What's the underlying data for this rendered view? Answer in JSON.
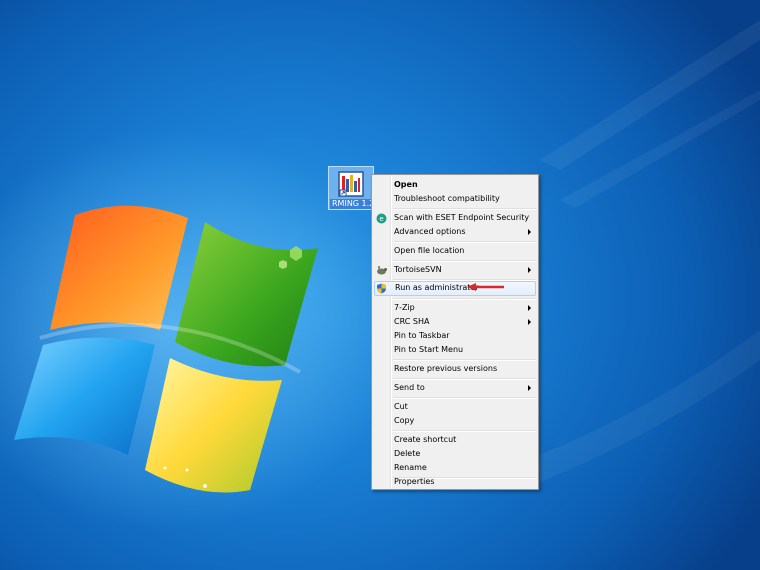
{
  "desktop": {
    "icon_label": "RMING 1.24",
    "accent_color": "#1a7fd4"
  },
  "context_menu": {
    "items": [
      {
        "label": "Open",
        "bold": true,
        "submenu": false,
        "icon": ""
      },
      {
        "label": "Troubleshoot compatibility",
        "bold": false,
        "submenu": false,
        "icon": ""
      },
      {
        "label": "Scan with ESET Endpoint Security",
        "bold": false,
        "submenu": false,
        "icon": "eset-icon"
      },
      {
        "label": "Advanced options",
        "bold": false,
        "submenu": true,
        "icon": ""
      },
      {
        "label": "Open file location",
        "bold": false,
        "submenu": false,
        "icon": ""
      },
      {
        "label": "TortoiseSVN",
        "bold": false,
        "submenu": true,
        "icon": "tortoise-svn-icon"
      },
      {
        "label": "Run as administrator",
        "bold": false,
        "submenu": false,
        "icon": "uac-shield-icon",
        "highlighted": true
      },
      {
        "label": "7-Zip",
        "bold": false,
        "submenu": true,
        "icon": ""
      },
      {
        "label": "CRC SHA",
        "bold": false,
        "submenu": true,
        "icon": ""
      },
      {
        "label": "Pin to Taskbar",
        "bold": false,
        "submenu": false,
        "icon": ""
      },
      {
        "label": "Pin to Start Menu",
        "bold": false,
        "submenu": false,
        "icon": ""
      },
      {
        "label": "Restore previous versions",
        "bold": false,
        "submenu": false,
        "icon": ""
      },
      {
        "label": "Send to",
        "bold": false,
        "submenu": true,
        "icon": ""
      },
      {
        "label": "Cut",
        "bold": false,
        "submenu": false,
        "icon": ""
      },
      {
        "label": "Copy",
        "bold": false,
        "submenu": false,
        "icon": ""
      },
      {
        "label": "Create shortcut",
        "bold": false,
        "submenu": false,
        "icon": ""
      },
      {
        "label": "Delete",
        "bold": false,
        "submenu": false,
        "icon": ""
      },
      {
        "label": "Rename",
        "bold": false,
        "submenu": false,
        "icon": ""
      },
      {
        "label": "Properties",
        "bold": false,
        "submenu": false,
        "icon": ""
      }
    ]
  },
  "annotation": {
    "color": "#d9292b",
    "icon": "red-arrow-icon"
  }
}
